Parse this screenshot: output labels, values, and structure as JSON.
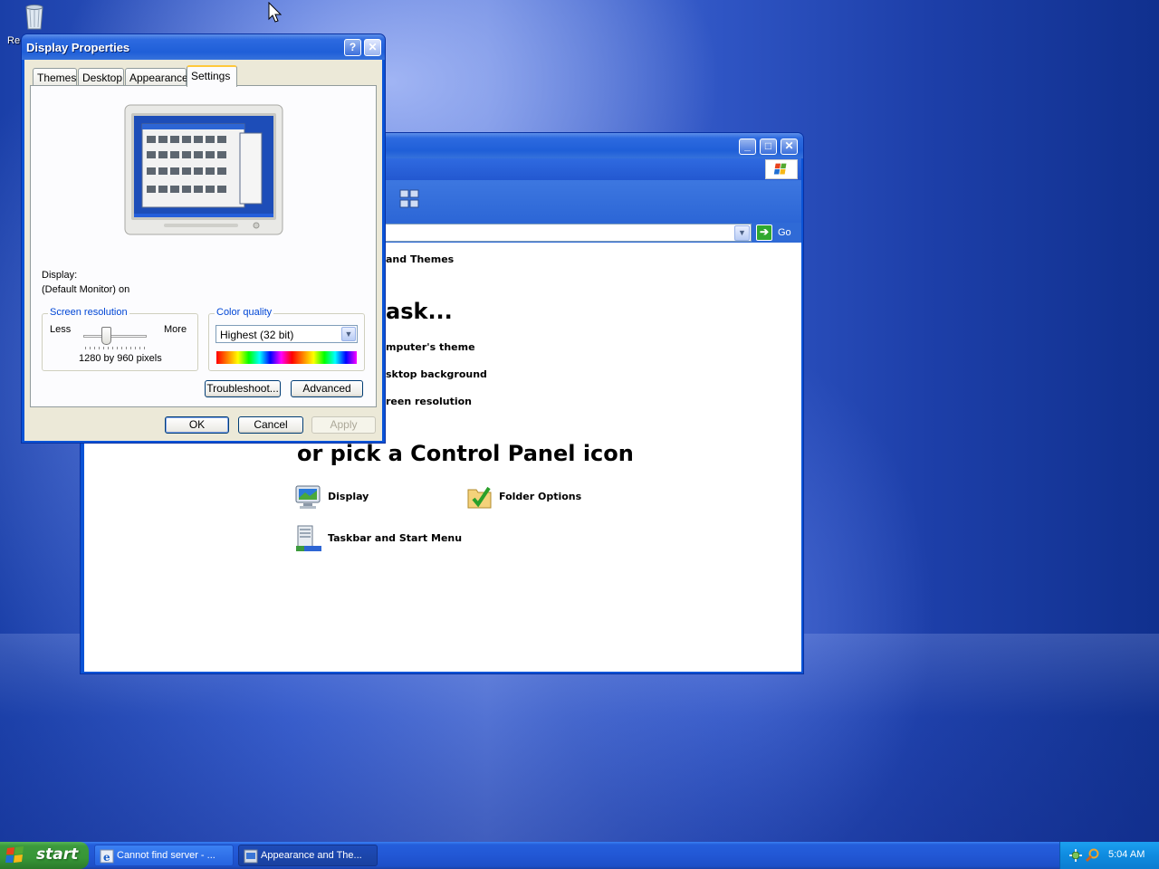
{
  "desktop": {
    "recycle_bin_label": "Re"
  },
  "control_panel": {
    "address_go": "Go",
    "category": "and Themes",
    "pick_task": "ask...",
    "tasks": [
      "mputer's theme",
      "sktop background",
      "reen resolution"
    ],
    "pick_icon": "or pick a Control Panel icon",
    "icons": [
      {
        "label": "Display",
        "icon": "display-icon"
      },
      {
        "label": "Folder Options",
        "icon": "folder-options-icon"
      },
      {
        "label": "Taskbar and Start Menu",
        "icon": "taskbar-start-menu-icon"
      }
    ]
  },
  "dialog": {
    "title": "Display Properties",
    "tabs": [
      "Themes",
      "Desktop",
      "Appearance",
      "Settings"
    ],
    "active_tab": "Settings",
    "display_label": "Display:",
    "display_value": "(Default Monitor) on",
    "resolution": {
      "group_title": "Screen resolution",
      "less": "Less",
      "more": "More",
      "value": "1280 by 960 pixels"
    },
    "color_quality": {
      "group_title": "Color quality",
      "selected": "Highest (32 bit)"
    },
    "buttons": {
      "troubleshoot": "Troubleshoot...",
      "advanced": "Advanced",
      "ok": "OK",
      "cancel": "Cancel",
      "apply": "Apply"
    }
  },
  "taskbar": {
    "start": "start",
    "tasks": [
      {
        "label": "Cannot find server - ...",
        "active": false
      },
      {
        "label": "Appearance and The...",
        "active": true
      }
    ],
    "clock": "5:04 AM"
  },
  "colors": {
    "xp_blue": "#0a53d6",
    "dialog_face": "#ece9d8",
    "start_green": "#379637",
    "tray_blue": "#0f8be0"
  }
}
